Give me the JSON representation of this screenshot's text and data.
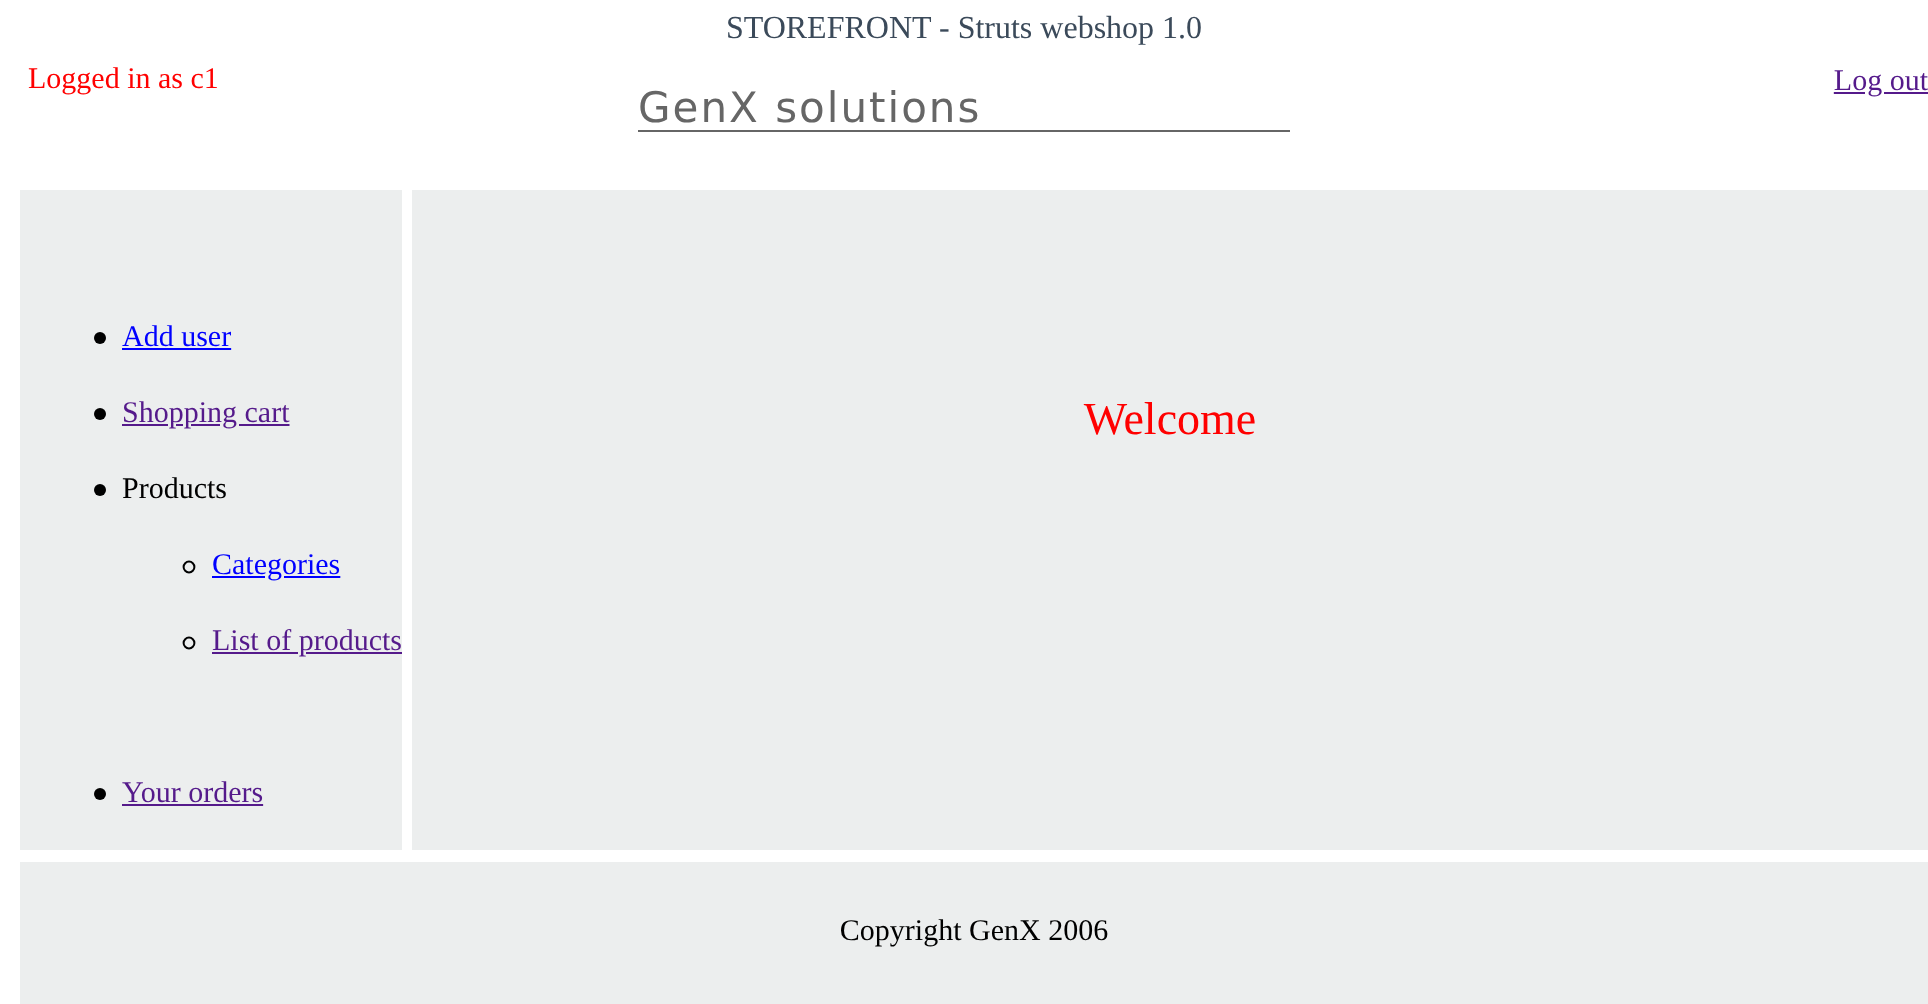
{
  "header": {
    "title": "STOREFRONT - Struts webshop 1.0",
    "login_status": "Logged in as c1",
    "logo": "GenX solutions",
    "logout_link": {
      "label": "Log out",
      "visited": true
    }
  },
  "sidebar": {
    "items": [
      {
        "label": "Add user",
        "kind": "link",
        "visited": false
      },
      {
        "label": "Shopping cart",
        "kind": "link",
        "visited": true
      },
      {
        "label": "Products",
        "kind": "text",
        "children": [
          {
            "label": "Categories",
            "kind": "link",
            "visited": false
          },
          {
            "label": "List of products",
            "kind": "link",
            "visited": true
          }
        ]
      },
      {
        "label": "Your orders",
        "kind": "link",
        "visited": true
      }
    ]
  },
  "main": {
    "heading": "Welcome"
  },
  "footer": {
    "copyright": "Copyright GenX 2006"
  }
}
